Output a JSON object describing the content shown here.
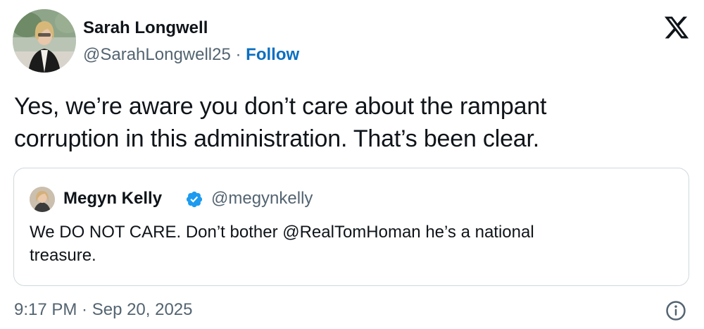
{
  "author": {
    "name": "Sarah Longwell",
    "handle": "@SarahLongwell25",
    "separator": " · ",
    "follow_label": "Follow"
  },
  "tweet": {
    "text": "Yes, we’re aware you don’t care about the rampant\ncorruption in this administration. That’s been clear.",
    "timestamp": "9:17 PM · Sep 20, 2025"
  },
  "quoted_tweet": {
    "name": "Megyn Kelly",
    "handle": "@megynkelly",
    "verified": true,
    "text": "We DO NOT CARE. Don’t bother @RealTomHoman he’s a national\ntreasure."
  },
  "icons": {
    "logo": "x-logo-icon",
    "verified": "verified-badge-icon",
    "info": "info-icon"
  },
  "colors": {
    "text": "#0f1419",
    "secondary": "#536471",
    "link": "#0a6fc2",
    "verified": "#1d9bf0",
    "border": "#cfd9de"
  }
}
